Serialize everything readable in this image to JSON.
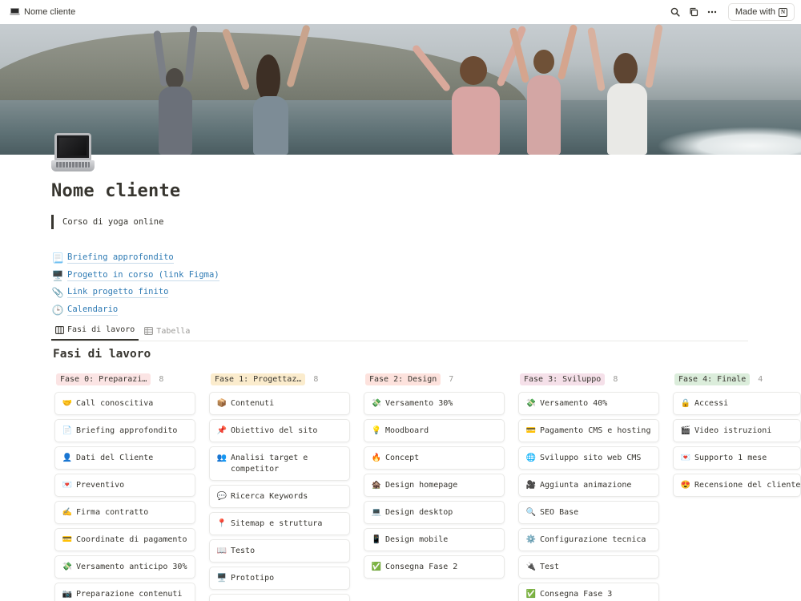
{
  "topbar": {
    "breadcrumb": "Nome cliente",
    "made_with": "Made with"
  },
  "page": {
    "title": "Nome cliente",
    "quote": "Corso di yoga online",
    "links": [
      {
        "emoji": "📃",
        "label": "Briefing approfondito"
      },
      {
        "emoji": "🖥️",
        "label": "Progetto in corso (link Figma)"
      },
      {
        "emoji": "📎",
        "label": "Link progetto finito"
      },
      {
        "emoji": "🕒",
        "label": "Calendario"
      }
    ],
    "tabs": [
      {
        "label": "Fasi di lavoro",
        "active": true
      },
      {
        "label": "Tabella",
        "active": false
      }
    ],
    "view_title": "Fasi di lavoro"
  },
  "board": {
    "columns": [
      {
        "name": "Fase 0: Preparazi…",
        "count": "8",
        "color": "#fbe4e4",
        "cards": [
          {
            "emoji": "🤝",
            "text": "Call conoscitiva"
          },
          {
            "emoji": "📄",
            "text": "Briefing approfondito"
          },
          {
            "emoji": "👤",
            "text": "Dati del Cliente"
          },
          {
            "emoji": "💌",
            "text": "Preventivo"
          },
          {
            "emoji": "✍️",
            "text": "Firma contratto"
          },
          {
            "emoji": "💳",
            "text": "Coordinate di pagamento"
          },
          {
            "emoji": "💸",
            "text": "Versamento anticipo 30%"
          },
          {
            "emoji": "📷",
            "text": "Preparazione contenuti"
          }
        ]
      },
      {
        "name": "Fase 1: Progettaz…",
        "count": "8",
        "color": "#fbeccd",
        "cards": [
          {
            "emoji": "📦",
            "text": "Contenuti"
          },
          {
            "emoji": "📌",
            "text": "Obiettivo del sito"
          },
          {
            "emoji": "👥",
            "text": "Analisi target e competitor"
          },
          {
            "emoji": "💬",
            "text": "Ricerca Keywords"
          },
          {
            "emoji": "📍",
            "text": "Sitemap e struttura"
          },
          {
            "emoji": "📖",
            "text": "Testo"
          },
          {
            "emoji": "🖥️",
            "text": "Prototipo"
          },
          {
            "emoji": "",
            "text": ""
          }
        ]
      },
      {
        "name": "Fase 2: Design",
        "count": "7",
        "color": "#fde2dd",
        "cards": [
          {
            "emoji": "💸",
            "text": "Versamento 30%"
          },
          {
            "emoji": "💡",
            "text": "Moodboard"
          },
          {
            "emoji": "🔥",
            "text": "Concept"
          },
          {
            "emoji": "🏚️",
            "text": "Design homepage"
          },
          {
            "emoji": "💻",
            "text": "Design desktop"
          },
          {
            "emoji": "📱",
            "text": "Design mobile"
          },
          {
            "emoji": "✅",
            "text": "Consegna Fase 2"
          }
        ]
      },
      {
        "name": "Fase 3: Sviluppo",
        "count": "8",
        "color": "#f5e0e9",
        "cards": [
          {
            "emoji": "💸",
            "text": "Versamento 40%"
          },
          {
            "emoji": "💳",
            "text": "Pagamento CMS e hosting"
          },
          {
            "emoji": "🌐",
            "text": "Sviluppo sito web CMS"
          },
          {
            "emoji": "🎥",
            "text": "Aggiunta animazione"
          },
          {
            "emoji": "🔍",
            "text": "SEO Base"
          },
          {
            "emoji": "⚙️",
            "text": "Configurazione tecnica"
          },
          {
            "emoji": "🔌",
            "text": "Test"
          },
          {
            "emoji": "✅",
            "text": "Consegna Fase 3"
          }
        ]
      },
      {
        "name": "Fase 4: Finale",
        "count": "4",
        "color": "#dbeddb",
        "cards": [
          {
            "emoji": "🔒",
            "text": "Accessi"
          },
          {
            "emoji": "🎬",
            "text": "Video istruzioni"
          },
          {
            "emoji": "💌",
            "text": "Supporto 1 mese"
          },
          {
            "emoji": "😍",
            "text": "Recensione del cliente"
          }
        ]
      }
    ]
  }
}
